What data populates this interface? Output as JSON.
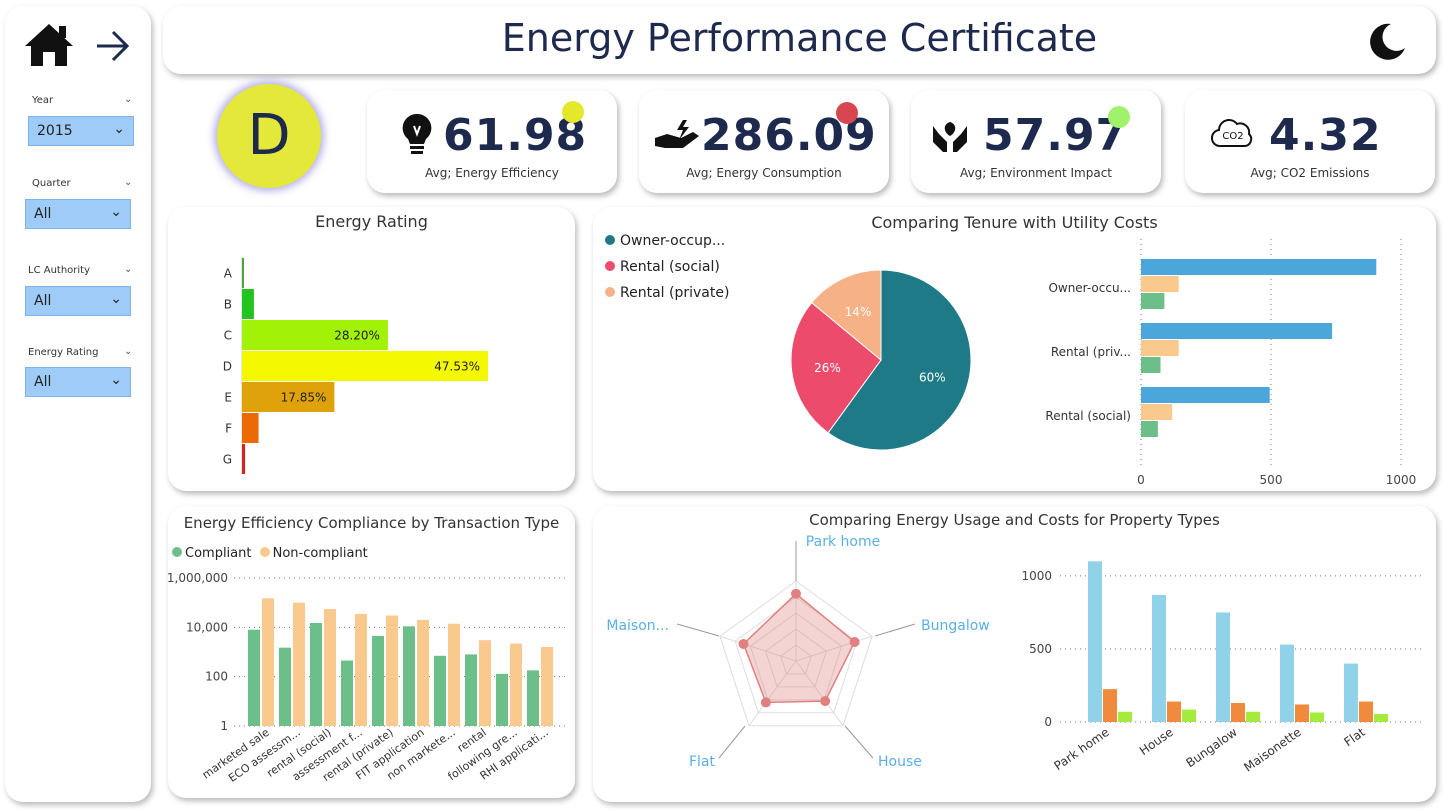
{
  "header": {
    "title": "Energy Performance Certificate"
  },
  "filters": [
    {
      "label": "Year",
      "value": "2015"
    },
    {
      "label": "Quarter",
      "value": "All"
    },
    {
      "label": "LC Authority",
      "value": "All"
    },
    {
      "label": "Energy Rating",
      "value": "All"
    }
  ],
  "rating_badge": {
    "letter": "D",
    "color": "#e3e83a"
  },
  "kpis": [
    {
      "value": "61.98",
      "label": "Avg; Energy Efficiency",
      "icon": "lightbulb-icon",
      "dot_color": "#e3e82a"
    },
    {
      "value": "286.09",
      "label": "Avg; Energy Consumption",
      "icon": "hand-energy-icon",
      "dot_color": "#d84751"
    },
    {
      "value": "57.97",
      "label": "Avg; Environment Impact",
      "icon": "hands-plant-icon",
      "dot_color": "#9ff26a"
    },
    {
      "value": "4.32",
      "label": "Avg; CO2 Emissions",
      "icon": "co2-cloud-icon",
      "dot_color": ""
    }
  ],
  "chart_data": [
    {
      "type": "bar",
      "title": "Energy Rating",
      "orientation": "horizontal",
      "categories": [
        "A",
        "B",
        "C",
        "D",
        "E",
        "F",
        "G"
      ],
      "values": [
        0.3,
        2.3,
        28.2,
        47.53,
        17.85,
        3.2,
        0.6
      ],
      "data_labels": [
        "",
        "",
        "28.20%",
        "47.53%",
        "17.85%",
        "",
        ""
      ],
      "colors": [
        "#4aa53a",
        "#23c41f",
        "#a2f208",
        "#f4f800",
        "#e0a20a",
        "#ec6a06",
        "#d0251c"
      ]
    },
    {
      "type": "pie",
      "title": "Comparing Tenure with Utility Costs",
      "legend": [
        "Owner-occup...",
        "Rental (social)",
        "Rental (private)"
      ],
      "legend_placement": "top-left",
      "slices": [
        {
          "name": "Owner-occup...",
          "value": 60,
          "label": "60%",
          "color": "#1f7a87"
        },
        {
          "name": "Rental (social)",
          "value": 26,
          "label": "26%",
          "color": "#ec4b6c"
        },
        {
          "name": "Rental (private)",
          "value": 14,
          "label": "14%",
          "color": "#f6b187"
        }
      ]
    },
    {
      "type": "bar",
      "orientation": "horizontal",
      "categories": [
        "Owner-occu...",
        "Rental (priv...",
        "Rental (social)"
      ],
      "series": [
        {
          "values": [
            905,
            735,
            495
          ],
          "color": "#4ba6dc"
        },
        {
          "values": [
            145,
            145,
            120
          ],
          "color": "#f9c98e"
        },
        {
          "values": [
            90,
            75,
            65
          ],
          "color": "#6dbf8a"
        }
      ],
      "xticks": [
        "0",
        "500",
        "1000"
      ],
      "xlim": [
        0,
        1000
      ]
    },
    {
      "type": "bar",
      "title": "Energy Efficiency Compliance by Transaction Type",
      "legend": [
        "Compliant",
        "Non-compliant"
      ],
      "legend_placement": "top-left",
      "yscale": "log",
      "yticks": [
        "1",
        "100",
        "10,000",
        "1,000,000"
      ],
      "categories": [
        "marketed sale",
        "ECO assessm...",
        "rental (social)",
        "assessment f...",
        "rental (private)",
        "FIT application",
        "non markete...",
        "rental",
        "following gre...",
        "RHI applicati..."
      ],
      "series": [
        {
          "name": "Compliant",
          "values": [
            8000,
            1500,
            15000,
            450,
            4500,
            11000,
            700,
            800,
            130,
            180
          ],
          "color": "#6dbf8a"
        },
        {
          "name": "Non-compliant",
          "values": [
            150000,
            100000,
            55000,
            35000,
            30000,
            20000,
            14000,
            3000,
            2200,
            1600
          ],
          "color": "#f9c98e"
        }
      ]
    },
    {
      "type": "radar",
      "title": "Comparing Energy Usage and Costs for Property Types",
      "axes": [
        "Park home",
        "Bungalow",
        "House",
        "Flat",
        "Maison..."
      ],
      "values": [
        0.84,
        0.77,
        0.62,
        0.64,
        0.69
      ],
      "color": "#e08080"
    },
    {
      "type": "bar",
      "categories": [
        "Park home",
        "House",
        "Bungalow",
        "Maisonette",
        "Flat"
      ],
      "series": [
        {
          "values": [
            1100,
            870,
            750,
            530,
            400
          ],
          "color": "#8fd2ea"
        },
        {
          "values": [
            225,
            140,
            130,
            120,
            140
          ],
          "color": "#f08a3c"
        },
        {
          "values": [
            70,
            85,
            70,
            65,
            55
          ],
          "color": "#a4eb3c"
        }
      ],
      "yticks": [
        "0",
        "500",
        "1000"
      ],
      "ylim": [
        0,
        1150
      ]
    }
  ]
}
